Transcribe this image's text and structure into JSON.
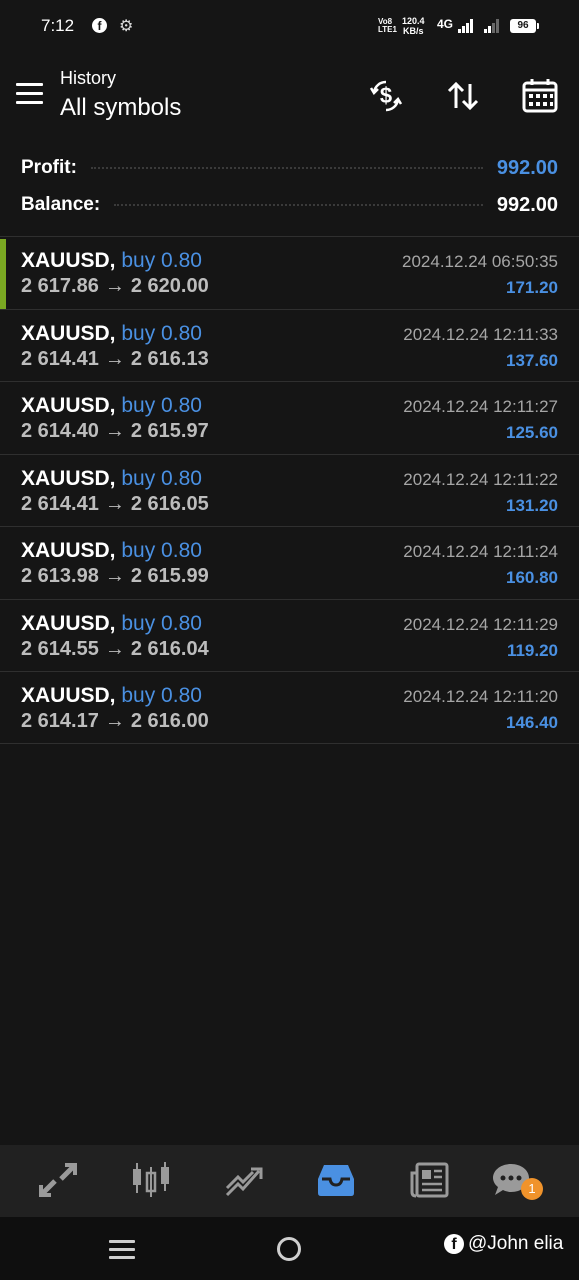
{
  "status_bar": {
    "time": "7:12",
    "volte": "Vo8 LTE1",
    "speed_value": "120.4",
    "speed_unit": "KB/s",
    "network": "4G",
    "battery": "96"
  },
  "header": {
    "subtitle": "History",
    "title": "All symbols",
    "icons": [
      "currency-exchange-icon",
      "sort-icon",
      "calendar-icon"
    ]
  },
  "summary": {
    "profit_label": "Profit:",
    "profit_value": "992.00",
    "balance_label": "Balance:",
    "balance_value": "992.00"
  },
  "colors": {
    "accent_blue": "#4a90e2",
    "selected_bar": "#7aa822",
    "badge": "#f0932b"
  },
  "trades": [
    {
      "symbol": "XAUUSD,",
      "side": "buy 0.80",
      "open": "2 617.86",
      "close": "2 620.00",
      "time": "2024.12.24 06:50:35",
      "profit": "171.20"
    },
    {
      "symbol": "XAUUSD,",
      "side": "buy 0.80",
      "open": "2 614.41",
      "close": "2 616.13",
      "time": "2024.12.24 12:11:33",
      "profit": "137.60"
    },
    {
      "symbol": "XAUUSD,",
      "side": "buy 0.80",
      "open": "2 614.40",
      "close": "2 615.97",
      "time": "2024.12.24 12:11:27",
      "profit": "125.60"
    },
    {
      "symbol": "XAUUSD,",
      "side": "buy 0.80",
      "open": "2 614.41",
      "close": "2 616.05",
      "time": "2024.12.24 12:11:22",
      "profit": "131.20"
    },
    {
      "symbol": "XAUUSD,",
      "side": "buy 0.80",
      "open": "2 613.98",
      "close": "2 615.99",
      "time": "2024.12.24 12:11:24",
      "profit": "160.80"
    },
    {
      "symbol": "XAUUSD,",
      "side": "buy 0.80",
      "open": "2 614.55",
      "close": "2 616.04",
      "time": "2024.12.24 12:11:29",
      "profit": "119.20"
    },
    {
      "symbol": "XAUUSD,",
      "side": "buy 0.80",
      "open": "2 614.17",
      "close": "2 616.00",
      "time": "2024.12.24 12:11:20",
      "profit": "146.40"
    }
  ],
  "tabbar": {
    "tabs": [
      "trade-icon",
      "chart-candles-icon",
      "chart-line-icon",
      "history-inbox-icon",
      "news-icon",
      "messages-icon"
    ],
    "active": "history-inbox-icon",
    "messages_badge": "1"
  },
  "watermark": {
    "logo": "f",
    "text": "@John elia"
  }
}
